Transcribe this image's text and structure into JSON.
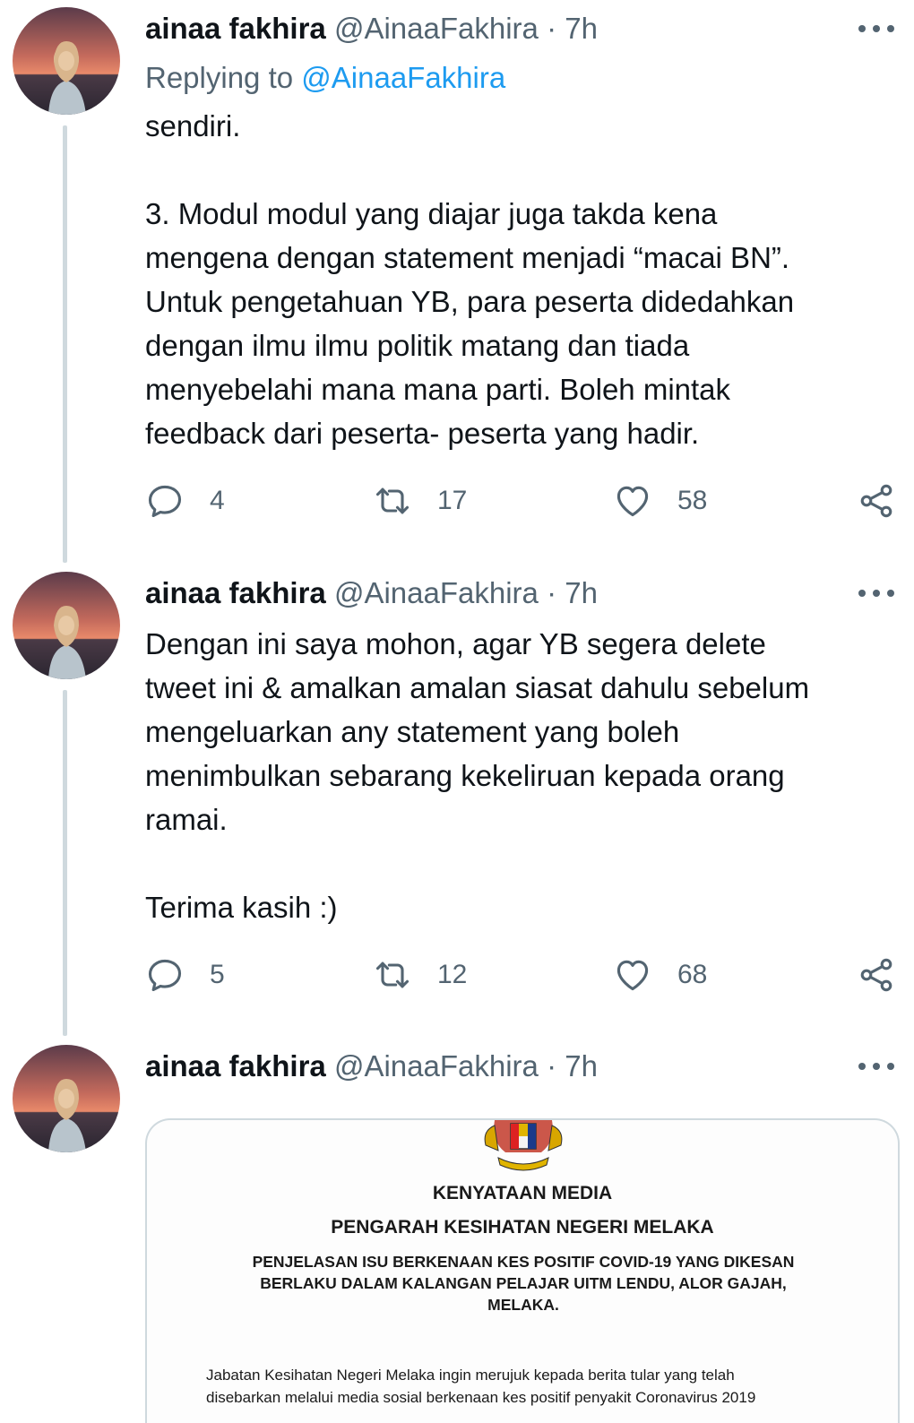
{
  "tweets": [
    {
      "name": "ainaa fakhira",
      "handle": "@AinaaFakhira",
      "dot": "·",
      "time": "7h",
      "replying_prefix": "Replying to ",
      "replying_handle": "@AinaaFakhira",
      "paragraphs": [
        "sendiri.",
        "3. Modul modul yang diajar juga takda kena\nmengena dengan statement menjadi “macai  BN”.\nUntuk pengetahuan YB, para peserta didedahkan\ndengan ilmu ilmu politik matang dan tiada\nmenyebelahi mana mana parti. Boleh mintak\nfeedback dari peserta- peserta yang hadir."
      ],
      "replies": "4",
      "retweets": "17",
      "likes": "58"
    },
    {
      "name": "ainaa fakhira",
      "handle": "@AinaaFakhira",
      "dot": "·",
      "time": "7h",
      "paragraphs": [
        "Dengan ini saya mohon, agar YB segera delete\ntweet ini & amalkan amalan siasat dahulu sebelum\nmengeluarkan any statement yang boleh\nmenimbulkan sebarang kekeliruan kepada orang\nramai.",
        "Terima kasih :)"
      ],
      "replies": "5",
      "retweets": "12",
      "likes": "68"
    },
    {
      "name": "ainaa fakhira",
      "handle": "@AinaaFakhira",
      "dot": "·",
      "time": "7h",
      "media": {
        "title": "KENYATAAN MEDIA",
        "subtitle": "PENGARAH KESIHATAN NEGERI MELAKA",
        "heading": "PENJELASAN ISU BERKENAAN KES POSITIF COVID-19 YANG DIKESAN\nBERLAKU DALAM KALANGAN PELAJAR UITM LENDU, ALOR GAJAH,\nMELAKA.",
        "paragraph": "Jabatan Kesihatan Negeri Melaka ingin merujuk kepada berita tular yang telah\ndisebarkan melalui media sosial berkenaan kes positif penyakit Coronavirus 2019"
      }
    }
  ],
  "icons": {
    "reply": "reply-icon",
    "retweet": "retweet-icon",
    "like": "heart-icon",
    "share": "share-icon",
    "more": "more-icon",
    "avatar": "avatar-sunset-photo",
    "crest": "malaysia-coat-of-arms-icon"
  },
  "colors": {
    "text": "#0f1419",
    "secondary": "#536471",
    "link": "#1d9bf0",
    "border": "#cfd9de"
  }
}
